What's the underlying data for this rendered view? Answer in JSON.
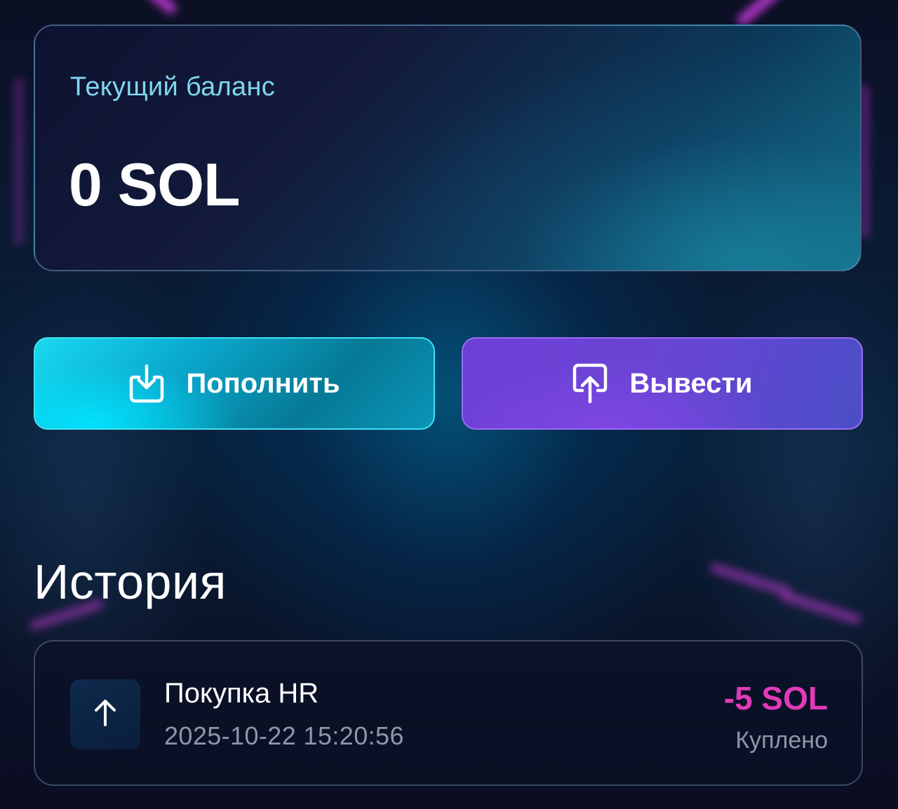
{
  "balance": {
    "label": "Текущий баланс",
    "value": "0 SOL"
  },
  "actions": {
    "deposit": {
      "label": "Пополнить",
      "icon": "download-tray-icon",
      "color": "#0fc6e0"
    },
    "withdraw": {
      "label": "Вывести",
      "icon": "upload-tray-icon",
      "color": "#6d3fd6"
    }
  },
  "history": {
    "title": "История",
    "items": [
      {
        "icon": "arrow-up-icon",
        "title": "Покупка HR",
        "date": "2025-10-22 15:20:56",
        "amount": "-5 SOL",
        "amount_color": "#e03ab8",
        "status": "Куплено"
      }
    ]
  }
}
